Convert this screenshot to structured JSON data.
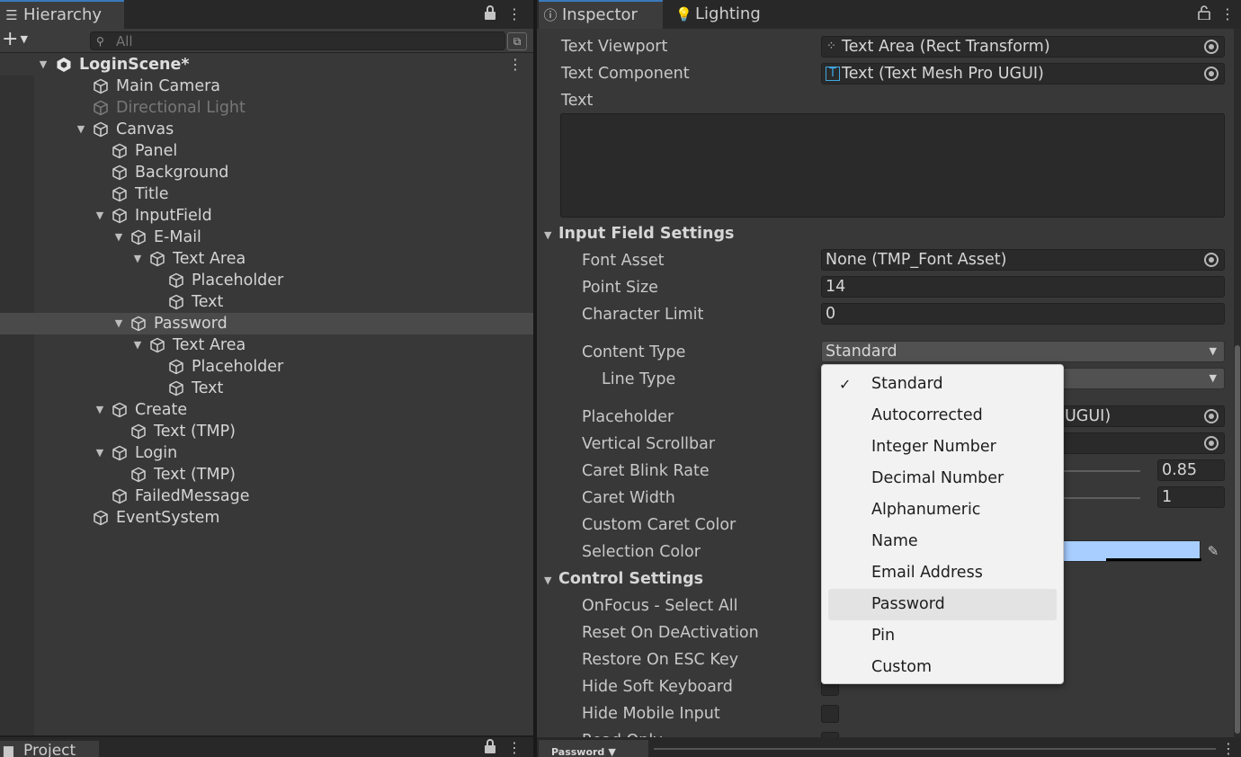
{
  "hierarchy": {
    "tab_label": "Hierarchy",
    "search_placeholder": "All",
    "tree": [
      {
        "label": "LoginScene*",
        "depth": 0,
        "fold": "open",
        "scene": true
      },
      {
        "label": "Main Camera",
        "depth": 1,
        "fold": "none"
      },
      {
        "label": "Directional Light",
        "depth": 1,
        "fold": "none",
        "inactive": true
      },
      {
        "label": "Canvas",
        "depth": 1,
        "fold": "open"
      },
      {
        "label": "Panel",
        "depth": 2,
        "fold": "none"
      },
      {
        "label": "Background",
        "depth": 2,
        "fold": "none"
      },
      {
        "label": "Title",
        "depth": 2,
        "fold": "none"
      },
      {
        "label": "InputField",
        "depth": 2,
        "fold": "open"
      },
      {
        "label": "E-Mail",
        "depth": 3,
        "fold": "open"
      },
      {
        "label": "Text Area",
        "depth": 4,
        "fold": "open"
      },
      {
        "label": "Placeholder",
        "depth": 5,
        "fold": "none"
      },
      {
        "label": "Text",
        "depth": 5,
        "fold": "none"
      },
      {
        "label": "Password",
        "depth": 3,
        "fold": "open",
        "selected": true
      },
      {
        "label": "Text Area",
        "depth": 4,
        "fold": "open"
      },
      {
        "label": "Placeholder",
        "depth": 5,
        "fold": "none"
      },
      {
        "label": "Text",
        "depth": 5,
        "fold": "none"
      },
      {
        "label": "Create",
        "depth": 2,
        "fold": "open"
      },
      {
        "label": "Text (TMP)",
        "depth": 3,
        "fold": "none"
      },
      {
        "label": "Login",
        "depth": 2,
        "fold": "open"
      },
      {
        "label": "Text (TMP)",
        "depth": 3,
        "fold": "none"
      },
      {
        "label": "FailedMessage",
        "depth": 2,
        "fold": "none"
      },
      {
        "label": "EventSystem",
        "depth": 1,
        "fold": "none"
      }
    ]
  },
  "project": {
    "tab_label": "Project"
  },
  "inspector": {
    "tabs": {
      "inspector": "Inspector",
      "lighting": "Lighting"
    },
    "text_viewport": {
      "label": "Text Viewport",
      "value": "Text Area (Rect Transform)"
    },
    "text_component": {
      "label": "Text Component",
      "value": "Text (Text Mesh Pro UGUI)"
    },
    "text_label": "Text",
    "input_settings": {
      "header": "Input Field Settings",
      "font_asset": {
        "label": "Font Asset",
        "value": "None (TMP_Font Asset)"
      },
      "point_size": {
        "label": "Point Size",
        "value": "14"
      },
      "character_limit": {
        "label": "Character Limit",
        "value": "0"
      },
      "content_type": {
        "label": "Content Type",
        "value": "Standard"
      },
      "line_type": {
        "label": "Line Type"
      },
      "placeholder": {
        "label": "Placeholder",
        "value_partial": "UGUI)"
      },
      "vertical_scrollbar": {
        "label": "Vertical Scrollbar"
      },
      "caret_blink_rate": {
        "label": "Caret Blink Rate",
        "value": "0.85"
      },
      "caret_width": {
        "label": "Caret Width",
        "value": "1"
      },
      "custom_caret_color": {
        "label": "Custom Caret Color"
      },
      "selection_color": {
        "label": "Selection Color",
        "color": "#a8ceff"
      }
    },
    "control_settings": {
      "header": "Control Settings",
      "onfocus_select_all": "OnFocus - Select All",
      "reset_on_deactivation": "Reset On DeActivation",
      "restore_on_esc": "Restore On ESC Key",
      "hide_soft_keyboard": "Hide Soft Keyboard",
      "hide_mobile_input": "Hide Mobile Input",
      "read_only": "Read Only"
    },
    "bottom_tab": "Password"
  },
  "content_type_popup": {
    "selected": "Standard",
    "hovered": "Password",
    "options": [
      "Standard",
      "Autocorrected",
      "Integer Number",
      "Decimal Number",
      "Alphanumeric",
      "Name",
      "Email Address",
      "Password",
      "Pin",
      "Custom"
    ]
  },
  "colors": {
    "accent": "#3a79bb",
    "panel": "#383838",
    "selection": "#a8ceff"
  }
}
